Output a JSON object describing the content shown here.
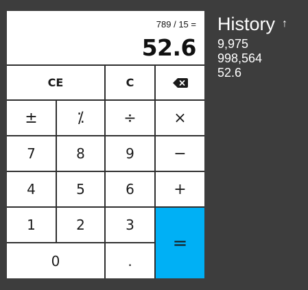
{
  "display": {
    "expression": "789 / 15 =",
    "result": "52.6"
  },
  "keys": {
    "ce": "CE",
    "c": "C",
    "backspace_icon": "backspace-icon",
    "plusminus": "±",
    "percent": "⁒",
    "divide": "÷",
    "multiply": "×",
    "seven": "7",
    "eight": "8",
    "nine": "9",
    "minus": "−",
    "four": "4",
    "five": "5",
    "six": "6",
    "plus": "+",
    "one": "1",
    "two": "2",
    "three": "3",
    "equals": "=",
    "zero": "0",
    "dot": "."
  },
  "history": {
    "title": "History",
    "arrow_icon": "arrow-up-icon",
    "items": [
      "9,975",
      "998,564",
      "52.6"
    ]
  },
  "colors": {
    "background": "#3d3d3d",
    "equals_key": "#00b0f5",
    "key": "#ffffff"
  }
}
